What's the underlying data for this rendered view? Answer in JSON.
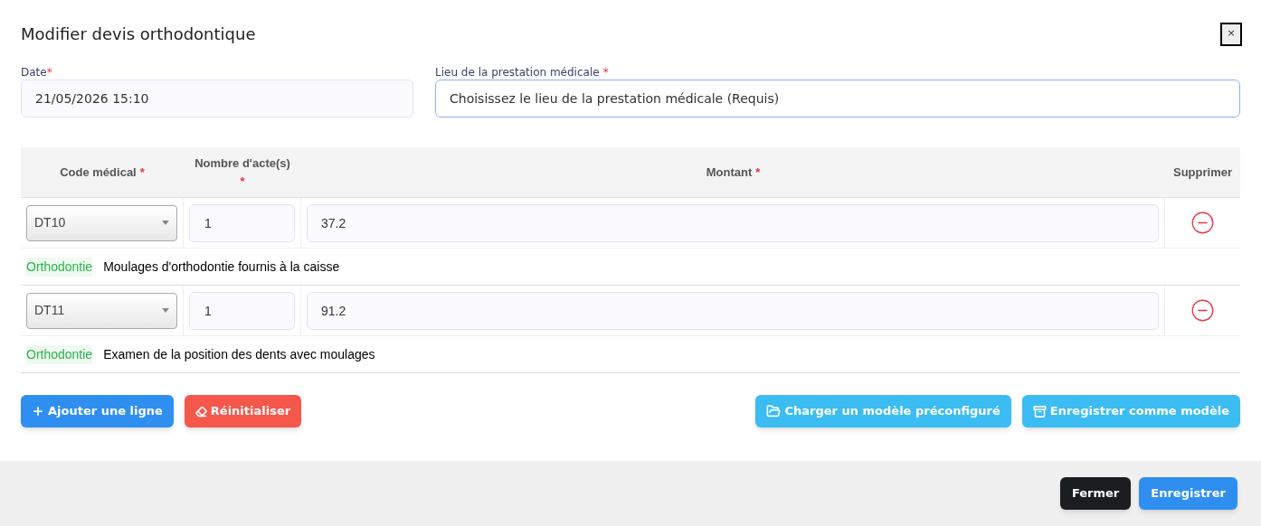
{
  "dialog": {
    "title": "Modifier devis orthodontique",
    "close": "×"
  },
  "fields": [
    {
      "label": "Date",
      "mark": "*",
      "value": "21/05/2026 15:10",
      "focused": false
    },
    {
      "label": "Lieu de la prestation médicale",
      "mark": "*",
      "placeholder": "Choisissez le lieu de la prestation médicale (Requis)",
      "focused": true
    }
  ],
  "table": {
    "columns": [
      {
        "label": "Code médical",
        "mark": "*"
      },
      {
        "label": "Nombre d'acte(s)",
        "mark": "*"
      },
      {
        "label": "Montant",
        "mark": "*"
      },
      {
        "label": "Supprimer"
      }
    ],
    "rows": [
      {
        "code": "DT10",
        "count": "1",
        "amount": "37.2",
        "category": "Orthodontie",
        "description": "Moulages d'orthodontie fournis à la caisse"
      },
      {
        "code": "DT11",
        "count": "1",
        "amount": "91.2",
        "category": "Orthodontie",
        "description": "Examen de la position des dents avec moulages"
      }
    ]
  },
  "actions": [
    {
      "kind": "add",
      "label": "Ajouter une ligne"
    },
    {
      "kind": "reset",
      "label": "Réinitialiser"
    },
    {
      "kind": "load",
      "label": "Charger un modèle préconfiguré"
    },
    {
      "kind": "save_template",
      "label": "Enregistrer comme modèle"
    }
  ],
  "footer": [
    {
      "kind": "close",
      "label": "Fermer"
    },
    {
      "kind": "save",
      "label": "Enregistrer"
    }
  ]
}
